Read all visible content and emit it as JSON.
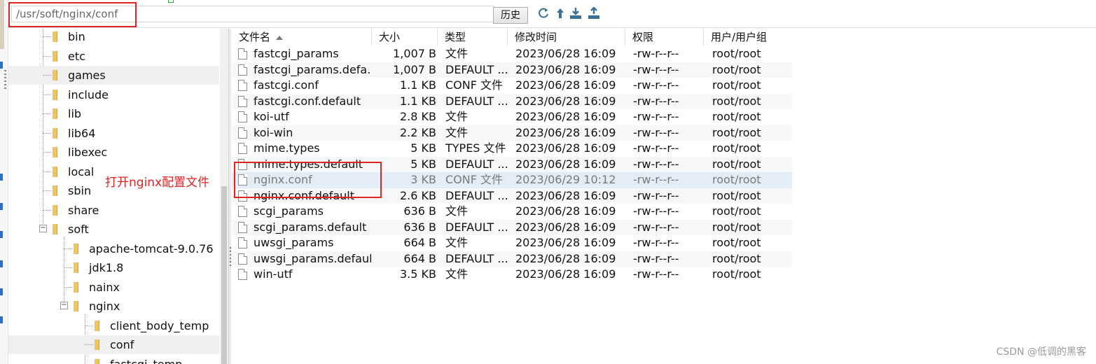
{
  "toolbar": {
    "path": "/usr/soft/nginx/conf",
    "history_label": "历史",
    "icons": [
      "refresh-icon",
      "up-icon",
      "download-icon",
      "upload-icon"
    ]
  },
  "tree": {
    "items": [
      {
        "label": "bin",
        "depth": 0
      },
      {
        "label": "etc",
        "depth": 0
      },
      {
        "label": "games",
        "depth": 0
      },
      {
        "label": "include",
        "depth": 0
      },
      {
        "label": "lib",
        "depth": 0
      },
      {
        "label": "lib64",
        "depth": 0
      },
      {
        "label": "libexec",
        "depth": 0
      },
      {
        "label": "local",
        "depth": 0
      },
      {
        "label": "sbin",
        "depth": 0
      },
      {
        "label": "share",
        "depth": 0
      },
      {
        "label": "soft",
        "depth": 0,
        "expanded": true
      },
      {
        "label": "apache-tomcat-9.0.76",
        "depth": 1
      },
      {
        "label": "jdk1.8",
        "depth": 1
      },
      {
        "label": "nainx",
        "depth": 1
      },
      {
        "label": "nginx",
        "depth": 1,
        "expanded": true
      },
      {
        "label": "client_body_temp",
        "depth": 2
      },
      {
        "label": "conf",
        "depth": 2,
        "selected": true
      },
      {
        "label": "fastcgi_temp",
        "depth": 2
      }
    ]
  },
  "annotation": {
    "text": "打开nginx配置文件",
    "color": "#e02424"
  },
  "filelist": {
    "columns": [
      "文件名",
      "大小",
      "类型",
      "修改时间",
      "权限",
      "用户/用户组"
    ],
    "rows": [
      {
        "name": "fastcgi_params",
        "size": "1,007 B",
        "type": "文件",
        "mtime": "2023/06/28 16:09",
        "perm": "-rw-r--r--",
        "owner": "root/root"
      },
      {
        "name": "fastcgi_params.defa...",
        "size": "1,007 B",
        "type": "DEFAULT ...",
        "mtime": "2023/06/28 16:09",
        "perm": "-rw-r--r--",
        "owner": "root/root"
      },
      {
        "name": "fastcgi.conf",
        "size": "1.1 KB",
        "type": "CONF 文件",
        "mtime": "2023/06/28 16:09",
        "perm": "-rw-r--r--",
        "owner": "root/root"
      },
      {
        "name": "fastcgi.conf.default",
        "size": "1.1 KB",
        "type": "DEFAULT ...",
        "mtime": "2023/06/28 16:09",
        "perm": "-rw-r--r--",
        "owner": "root/root"
      },
      {
        "name": "koi-utf",
        "size": "2.8 KB",
        "type": "文件",
        "mtime": "2023/06/28 16:09",
        "perm": "-rw-r--r--",
        "owner": "root/root"
      },
      {
        "name": "koi-win",
        "size": "2.2 KB",
        "type": "文件",
        "mtime": "2023/06/28 16:09",
        "perm": "-rw-r--r--",
        "owner": "root/root"
      },
      {
        "name": "mime.types",
        "size": "5 KB",
        "type": "TYPES 文件",
        "mtime": "2023/06/28 16:09",
        "perm": "-rw-r--r--",
        "owner": "root/root"
      },
      {
        "name": "mime.types.default",
        "size": "5 KB",
        "type": "DEFAULT ...",
        "mtime": "2023/06/28 16:09",
        "perm": "-rw-r--r--",
        "owner": "root/root"
      },
      {
        "name": "nginx.conf",
        "size": "3 KB",
        "type": "CONF 文件",
        "mtime": "2023/06/29 10:12",
        "perm": "-rw-r--r--",
        "owner": "root/root",
        "selected": true
      },
      {
        "name": "nginx.conf.default",
        "size": "2.6 KB",
        "type": "DEFAULT ...",
        "mtime": "2023/06/28 16:09",
        "perm": "-rw-r--r--",
        "owner": "root/root"
      },
      {
        "name": "scgi_params",
        "size": "636 B",
        "type": "文件",
        "mtime": "2023/06/28 16:09",
        "perm": "-rw-r--r--",
        "owner": "root/root"
      },
      {
        "name": "scgi_params.default",
        "size": "636 B",
        "type": "DEFAULT ...",
        "mtime": "2023/06/28 16:09",
        "perm": "-rw-r--r--",
        "owner": "root/root"
      },
      {
        "name": "uwsgi_params",
        "size": "664 B",
        "type": "文件",
        "mtime": "2023/06/28 16:09",
        "perm": "-rw-r--r--",
        "owner": "root/root"
      },
      {
        "name": "uwsgi_params.default",
        "size": "664 B",
        "type": "DEFAULT ...",
        "mtime": "2023/06/28 16:09",
        "perm": "-rw-r--r--",
        "owner": "root/root"
      },
      {
        "name": "win-utf",
        "size": "3.5 KB",
        "type": "文件",
        "mtime": "2023/06/28 16:09",
        "perm": "-rw-r--r--",
        "owner": "root/root"
      }
    ]
  },
  "watermark": "CSDN @低调的黑客"
}
